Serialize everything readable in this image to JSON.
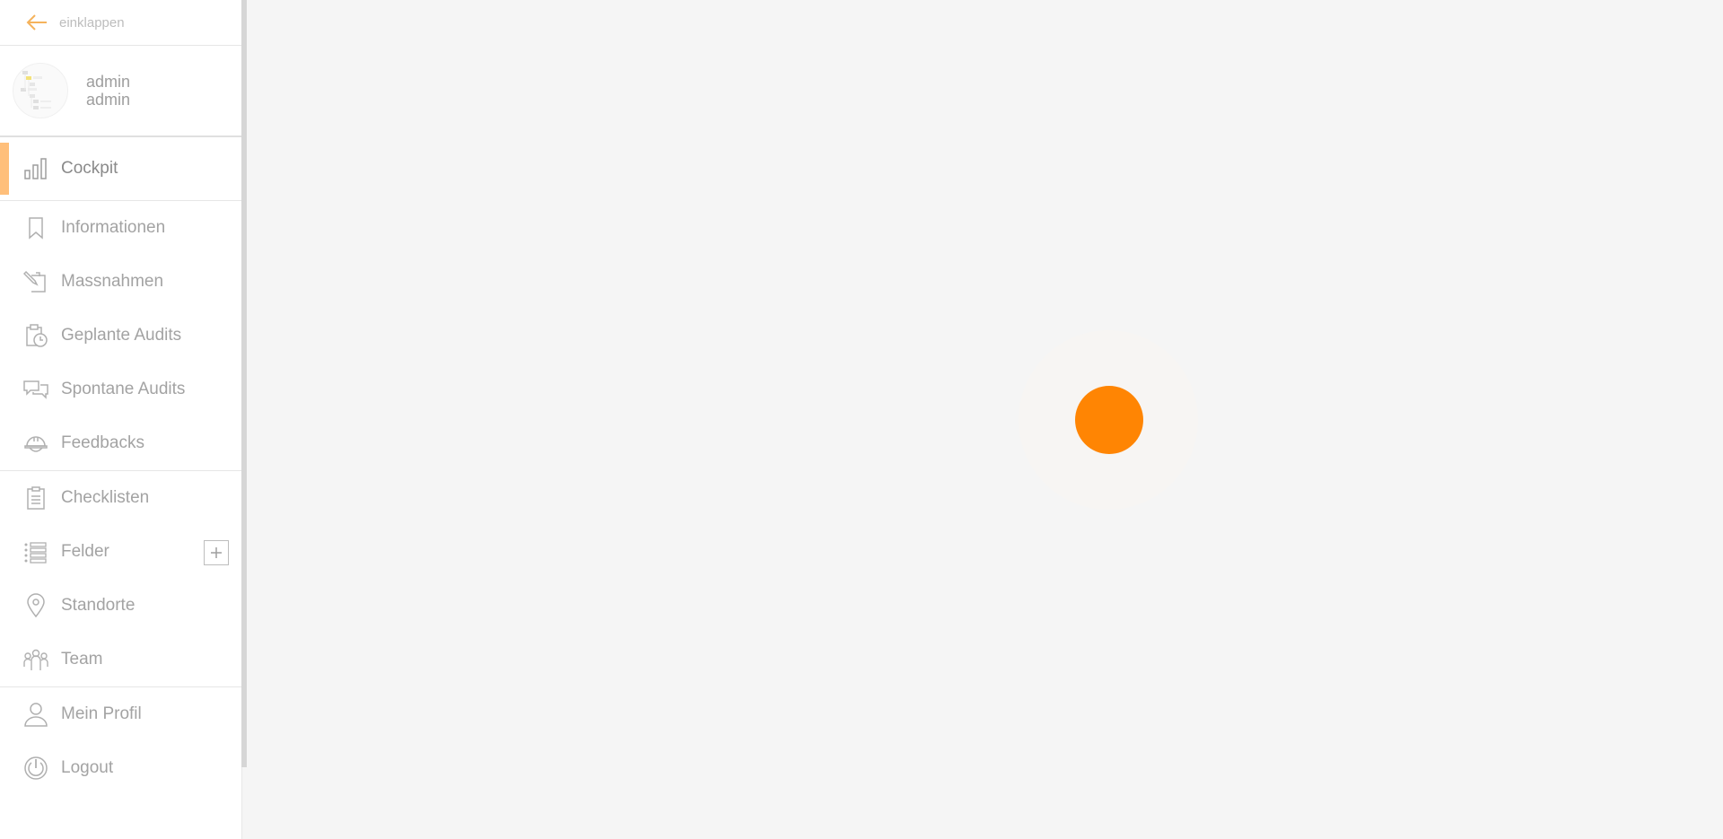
{
  "sidebar": {
    "collapse_label": "einklappen",
    "user": {
      "first_name": "admin",
      "last_name": "admin"
    },
    "items_primary": [
      {
        "label": "Cockpit",
        "icon": "bar-chart-icon",
        "active": true
      }
    ],
    "items_group1": [
      {
        "label": "Informationen",
        "icon": "bookmark-icon"
      },
      {
        "label": "Massnahmen",
        "icon": "task-pen-icon"
      },
      {
        "label": "Geplante Audits",
        "icon": "clipboard-clock-icon"
      },
      {
        "label": "Spontane Audits",
        "icon": "chat-bubbles-icon"
      },
      {
        "label": "Feedbacks",
        "icon": "helmet-icon"
      }
    ],
    "items_group2": [
      {
        "label": "Checklisten",
        "icon": "clipboard-list-icon"
      },
      {
        "label": "Felder",
        "icon": "list-icon",
        "has_add": true
      },
      {
        "label": "Standorte",
        "icon": "location-pin-icon"
      },
      {
        "label": "Team",
        "icon": "team-icon"
      }
    ],
    "items_group3": [
      {
        "label": "Mein Profil",
        "icon": "user-icon"
      },
      {
        "label": "Logout",
        "icon": "power-icon"
      }
    ]
  },
  "colors": {
    "accent": "#ff8503",
    "active_marker": "#ffbf7a",
    "collapse_arrow": "#f5b35c"
  },
  "main": {
    "loading_indicator": "orange-dot-loader"
  }
}
